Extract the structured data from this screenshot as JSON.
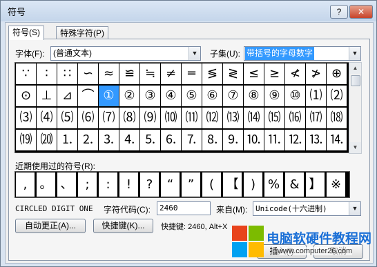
{
  "window": {
    "title": "符号",
    "help_label": "?",
    "close_label": "✕"
  },
  "tabs": [
    {
      "label": "符号(S)"
    },
    {
      "label": "特殊字符(P)"
    }
  ],
  "font": {
    "label": "字体(F):",
    "value": "(普通文本)"
  },
  "subset": {
    "label": "子集(U):",
    "value": "带括号的字母数字"
  },
  "symbol_grid": [
    [
      "∵",
      "∶",
      "∷",
      "∽",
      "≈",
      "≌",
      "≒",
      "≠",
      "═",
      "≶",
      "≷",
      "≤",
      "≥",
      "≮",
      "≯",
      "⊕"
    ],
    [
      "⊙",
      "⊥",
      "⊿",
      "⌒",
      "①",
      "②",
      "③",
      "④",
      "⑤",
      "⑥",
      "⑦",
      "⑧",
      "⑨",
      "⑩",
      "⑴",
      "⑵"
    ],
    [
      "⑶",
      "⑷",
      "⑸",
      "⑹",
      "⑺",
      "⑻",
      "⑼",
      "⑽",
      "⑾",
      "⑿",
      "⒀",
      "⒁",
      "⒂",
      "⒃",
      "⒄",
      "⒅"
    ],
    [
      "⒆",
      "⒇",
      "⒈",
      "⒉",
      "⒊",
      "⒋",
      "⒌",
      "⒍",
      "⒎",
      "⒏",
      "⒐",
      "⒑",
      "⒒",
      "⒓",
      "⒔",
      "⒕"
    ]
  ],
  "selected_symbol": {
    "row": 1,
    "col": 4
  },
  "recent": {
    "label": "近期使用过的符号(R):",
    "symbols": [
      ",",
      "。",
      "、",
      ";",
      ":",
      "!",
      "?",
      "“",
      "”",
      "(",
      "【",
      ")",
      "%",
      "&",
      "】",
      "※"
    ]
  },
  "char_name": "CIRCLED DIGIT ONE",
  "char_code": {
    "label": "字符代码(C):",
    "value": "2460"
  },
  "from": {
    "label": "来自(M):",
    "value": "Unicode(十六进制)"
  },
  "buttons": {
    "autocorrect": "自动更正(A)...",
    "shortcut_key": "快捷键(K)...",
    "insert": "插入(I)",
    "cancel": "取消"
  },
  "shortcut_text": "快捷键: 2460, Alt+X",
  "watermark": {
    "title": "电脑软硬件教程网",
    "url": "www.computer26.com"
  },
  "scroll": {
    "up_icon": "▲",
    "down_icon": "▼"
  },
  "dropdown_icon": "▼"
}
